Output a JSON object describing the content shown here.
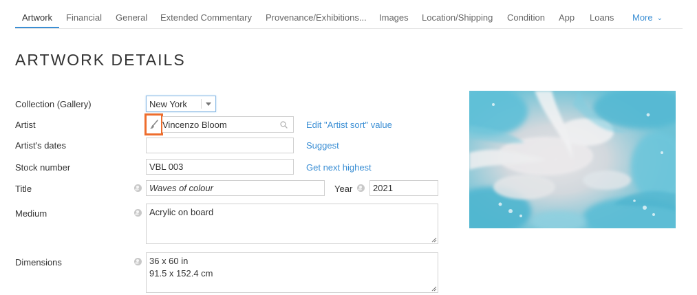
{
  "tabs": [
    {
      "label": "Artwork",
      "active": true
    },
    {
      "label": "Financial"
    },
    {
      "label": "General"
    },
    {
      "label": "Extended Commentary"
    },
    {
      "label": "Provenance/Exhibitions..."
    },
    {
      "label": "Images"
    },
    {
      "label": "Location/Shipping"
    },
    {
      "label": "Condition"
    },
    {
      "label": "App"
    },
    {
      "label": "Loans"
    }
  ],
  "more_label": "More",
  "page_title": "ARTWORK DETAILS",
  "form": {
    "collection": {
      "label": "Collection (Gallery)",
      "value": "New York"
    },
    "artist": {
      "label": "Artist",
      "value": "Vincenzo Bloom",
      "link": "Edit \"Artist sort\" value"
    },
    "artist_dates": {
      "label": "Artist's dates",
      "value": "",
      "link": "Suggest"
    },
    "stock_number": {
      "label": "Stock number",
      "value": "VBL 003",
      "link": "Get next highest"
    },
    "title": {
      "label": "Title",
      "value": "Waves of colour"
    },
    "year": {
      "label": "Year",
      "value": "2021"
    },
    "medium": {
      "label": "Medium",
      "value": "Acrylic on board"
    },
    "dimensions": {
      "label": "Dimensions",
      "value": "36 x 60 in\n91.5 x 152.4 cm"
    }
  },
  "colors": {
    "accent": "#3a8ed4",
    "highlight": "#ee6d2d"
  },
  "icons": {
    "brush": "paintbrush-icon",
    "search": "search-icon",
    "globe": "globe-icon",
    "dropdown": "chevron-down-icon"
  }
}
